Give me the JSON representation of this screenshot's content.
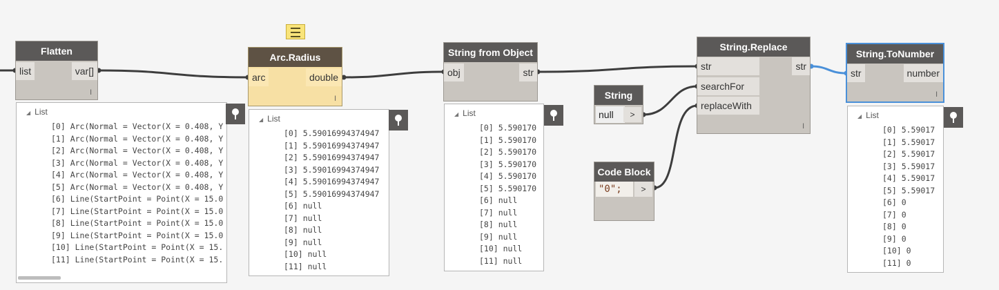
{
  "nodes": {
    "flatten": {
      "title": "Flatten",
      "input": "list",
      "output": "var[]",
      "lacing": "l",
      "preview": {
        "header": "List",
        "items": [
          "[0] Arc(Normal = Vector(X = 0.408, Y",
          "[1] Arc(Normal = Vector(X = 0.408, Y",
          "[2] Arc(Normal = Vector(X = 0.408, Y",
          "[3] Arc(Normal = Vector(X = 0.408, Y",
          "[4] Arc(Normal = Vector(X = 0.408, Y",
          "[5] Arc(Normal = Vector(X = 0.408, Y",
          "[6] Line(StartPoint = Point(X = 15.0",
          "[7] Line(StartPoint = Point(X = 15.0",
          "[8] Line(StartPoint = Point(X = 15.0",
          "[9] Line(StartPoint = Point(X = 15.0",
          "[10] Line(StartPoint = Point(X = 15.",
          "[11] Line(StartPoint = Point(X = 15."
        ]
      }
    },
    "arc_radius": {
      "title": "Arc.Radius",
      "input": "arc",
      "output": "double",
      "lacing": "l",
      "preview": {
        "header": "List",
        "items": [
          "[0] 5.59016994374947",
          "[1] 5.59016994374947",
          "[2] 5.59016994374947",
          "[3] 5.59016994374947",
          "[4] 5.59016994374947",
          "[5] 5.59016994374947",
          "[6] null",
          "[7] null",
          "[8] null",
          "[9] null",
          "[10] null",
          "[11] null"
        ]
      }
    },
    "string_from_object": {
      "title": "String from Object",
      "input": "obj",
      "output": "str",
      "preview": {
        "header": "List",
        "items": [
          "[0] 5.590170",
          "[1] 5.590170",
          "[2] 5.590170",
          "[3] 5.590170",
          "[4] 5.590170",
          "[5] 5.590170",
          "[6] null",
          "[7] null",
          "[8] null",
          "[9] null",
          "[10] null",
          "[11] null"
        ]
      }
    },
    "string_input": {
      "title": "String",
      "value": "null",
      "output": ">"
    },
    "code_block": {
      "title": "Code Block",
      "code": "\"0\";",
      "output": ">"
    },
    "string_replace": {
      "title": "String.Replace",
      "inputs": [
        "str",
        "searchFor",
        "replaceWith"
      ],
      "output": "str",
      "lacing": "l"
    },
    "string_to_number": {
      "title": "String.ToNumber",
      "input": "str",
      "output": "number",
      "lacing": "l",
      "preview": {
        "header": "List",
        "items": [
          "[0] 5.59017",
          "[1] 5.59017",
          "[2] 5.59017",
          "[3] 5.59017",
          "[4] 5.59017",
          "[5] 5.59017",
          "[6] 0",
          "[7] 0",
          "[8] 0",
          "[9] 0",
          "[10] 0",
          "[11] 0"
        ]
      }
    }
  },
  "icons": {
    "pin": "pin-icon",
    "note": "note-icon"
  },
  "colors": {
    "canvas": "#f5f5f5",
    "node_body": "#c9c5bf",
    "node_header": "#5b5958",
    "warning_body": "#f7e0a4",
    "selected_wire": "#4a90d9",
    "wire": "#3d3d3d"
  }
}
